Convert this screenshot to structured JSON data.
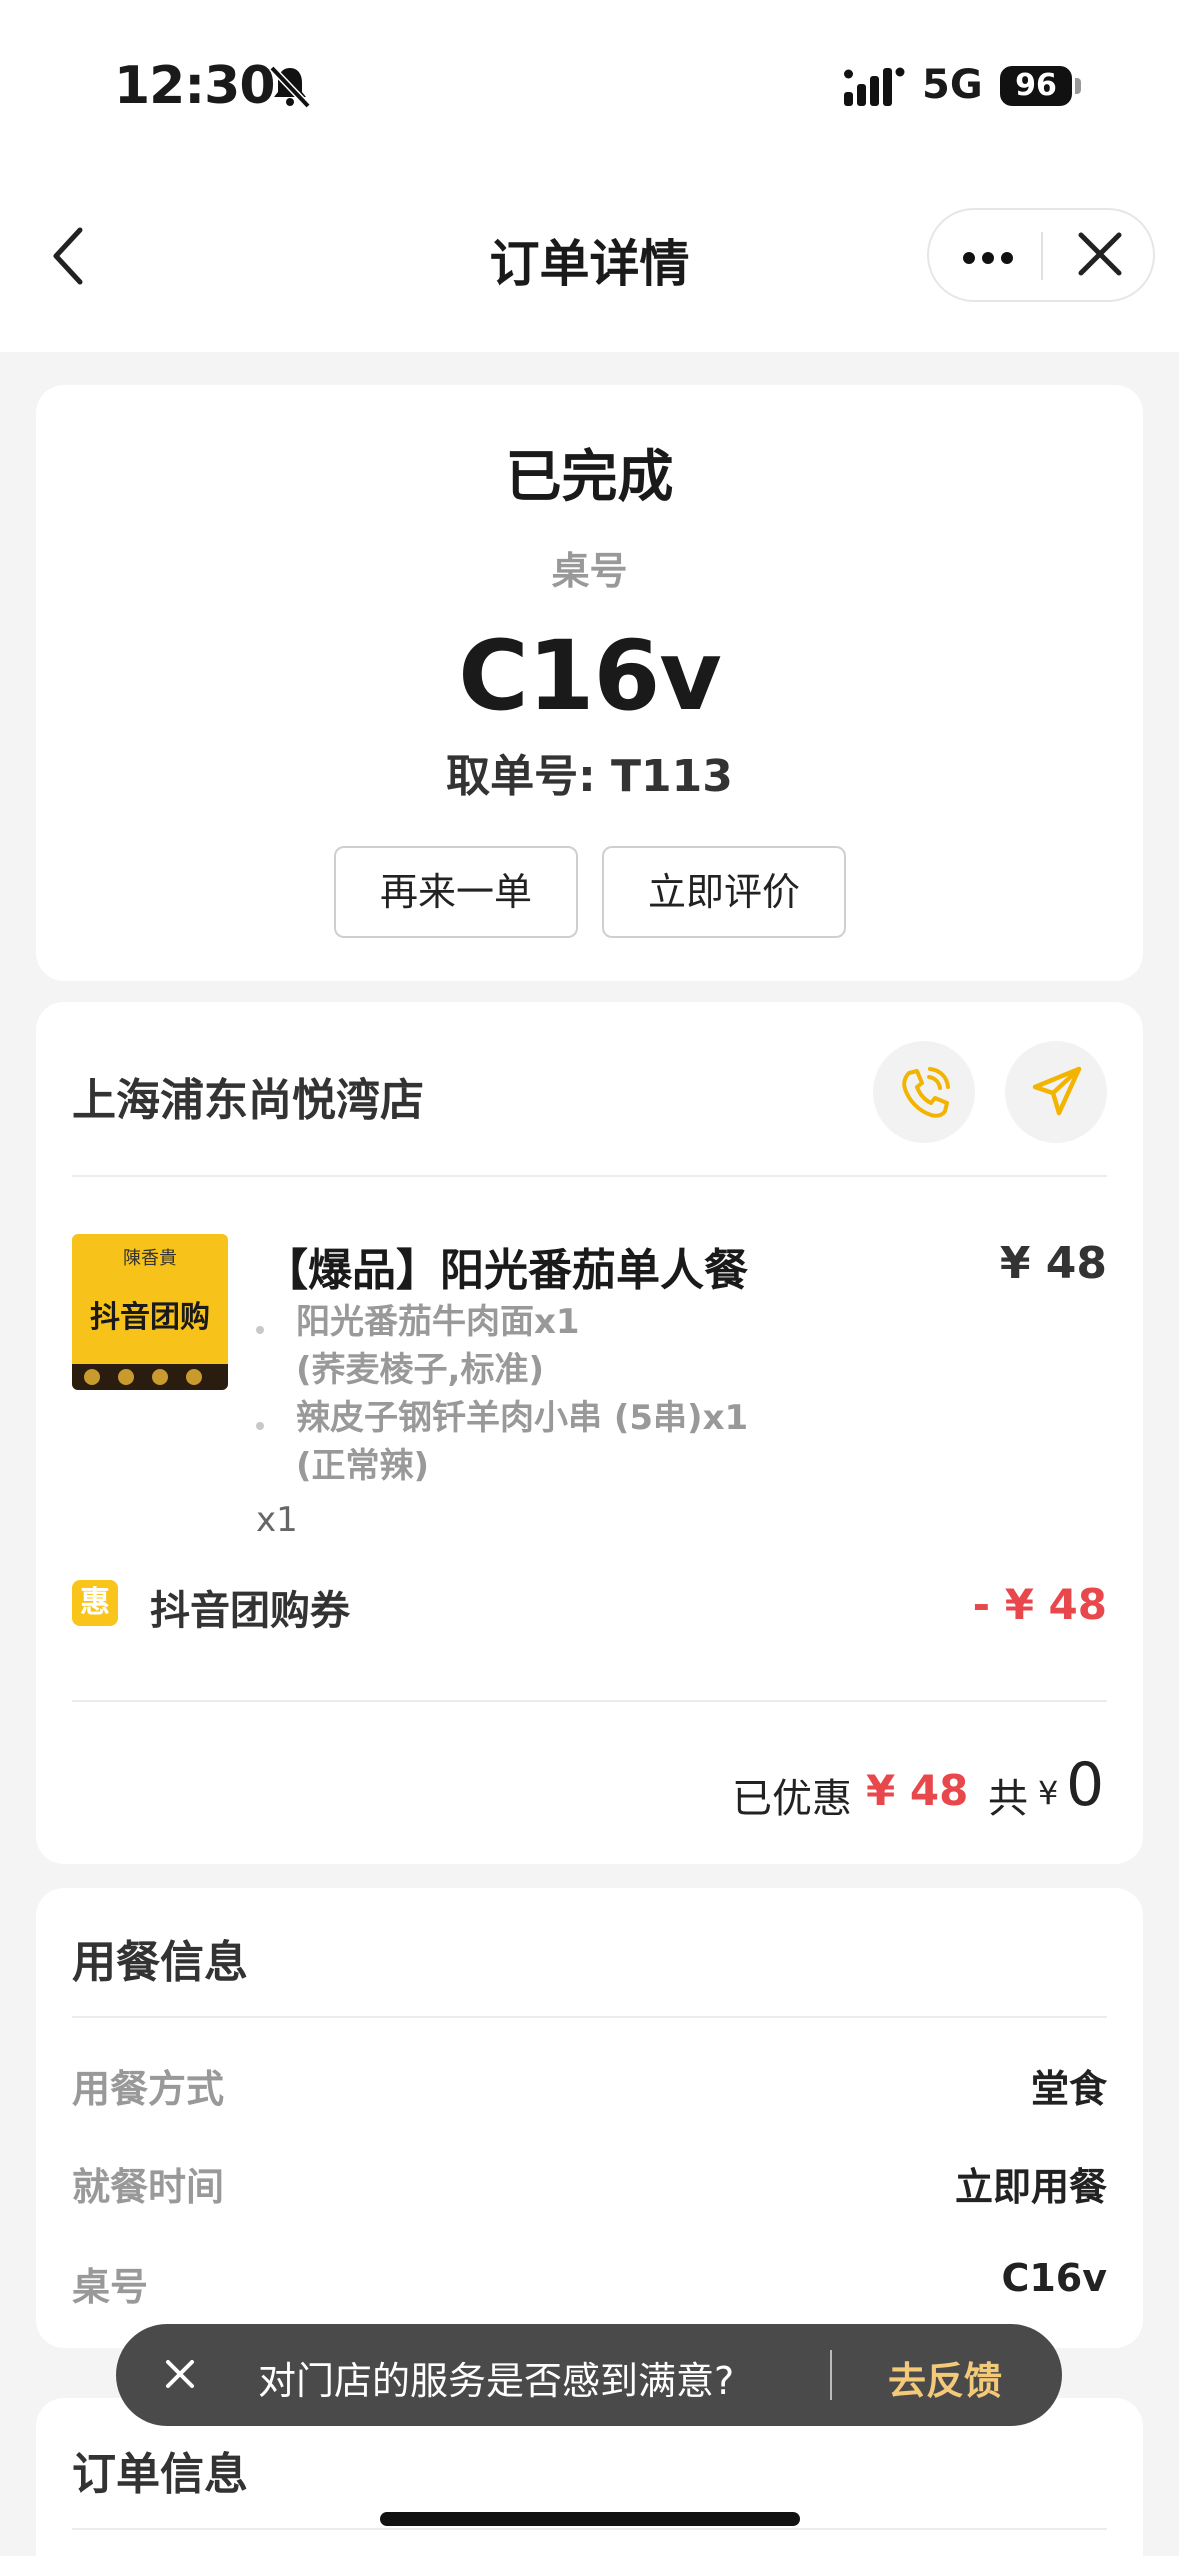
{
  "status_bar": {
    "time": "12:30",
    "network": "5G",
    "battery": "96"
  },
  "nav": {
    "title": "订单详情"
  },
  "order_status": {
    "status": "已完成",
    "table_label": "桌号",
    "table_number": "C16v",
    "pickup_label": "取单号: ",
    "pickup_number": "T113",
    "reorder_button": "再来一单",
    "review_button": "立即评价"
  },
  "store": {
    "name": "上海浦东尚悦湾店"
  },
  "item": {
    "thumb_brand": "陳香貴",
    "thumb_text": "抖音团购",
    "name": "【爆品】阳光番茄单人餐",
    "price": "¥ 48",
    "sub_items": [
      {
        "name": "阳光番茄牛肉面x1",
        "detail": "(荞麦棱子,标准)"
      },
      {
        "name": "辣皮子钢钎羊肉小串 (5串)x1",
        "detail": "(正常辣)"
      }
    ],
    "quantity": "x1"
  },
  "coupon": {
    "badge": "惠",
    "label": "抖音团购券",
    "amount": "- ¥ 48"
  },
  "summary": {
    "saved_label": "已优惠",
    "saved_amount": "¥ 48",
    "total_label": "共",
    "total_currency": "¥",
    "total_amount": "0"
  },
  "dining_info": {
    "title": "用餐信息",
    "rows": [
      {
        "label": "用餐方式",
        "value": "堂食"
      },
      {
        "label": "就餐时间",
        "value": "立即用餐"
      },
      {
        "label": "桌号",
        "value": "C16v"
      }
    ]
  },
  "order_info": {
    "title": "订单信息"
  },
  "toast": {
    "message": "对门店的服务是否感到满意?",
    "action": "去反馈"
  },
  "colors": {
    "accent_yellow": "#f9c51b",
    "price_red": "#e8474c",
    "toast_action": "#f3c97a"
  }
}
